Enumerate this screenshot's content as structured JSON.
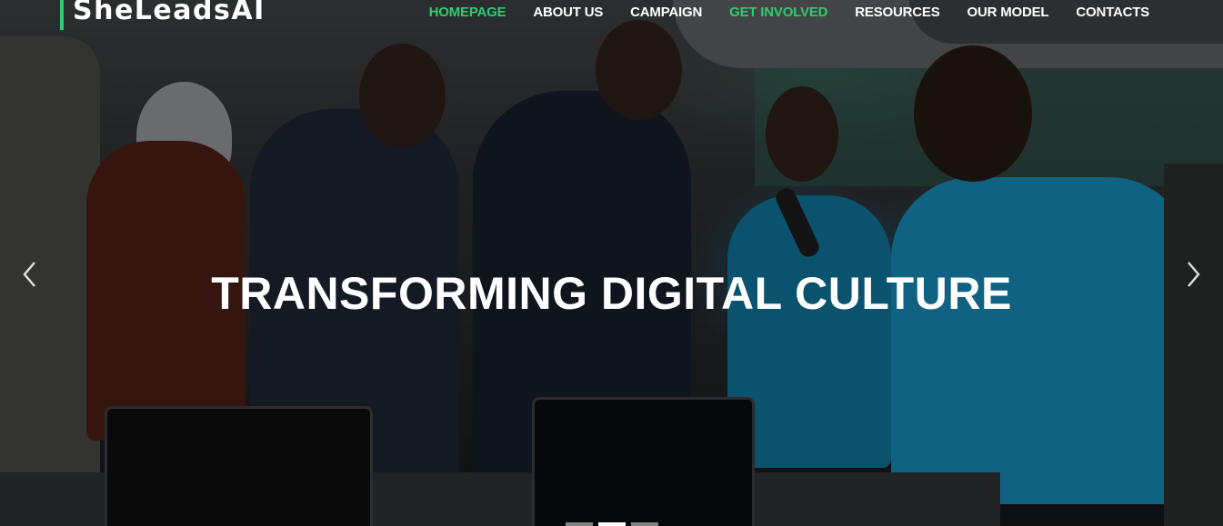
{
  "brand": {
    "name": "SheLeadsAI",
    "accent_color": "#2ecc71"
  },
  "nav": {
    "items": [
      {
        "label": "HOMEPAGE",
        "state": "active"
      },
      {
        "label": "ABOUT US",
        "state": "normal"
      },
      {
        "label": "CAMPAIGN",
        "state": "normal"
      },
      {
        "label": "GET INVOLVED",
        "state": "accent"
      },
      {
        "label": "RESOURCES",
        "state": "normal"
      },
      {
        "label": "OUR MODEL",
        "state": "normal"
      },
      {
        "label": "CONTACTS",
        "state": "normal"
      }
    ]
  },
  "carousel": {
    "caption": "TRANSFORMING DIGITAL CULTURE",
    "prev_icon": "chevron-left-icon",
    "next_icon": "chevron-right-icon",
    "slide_count": 3,
    "active_slide": 2
  }
}
